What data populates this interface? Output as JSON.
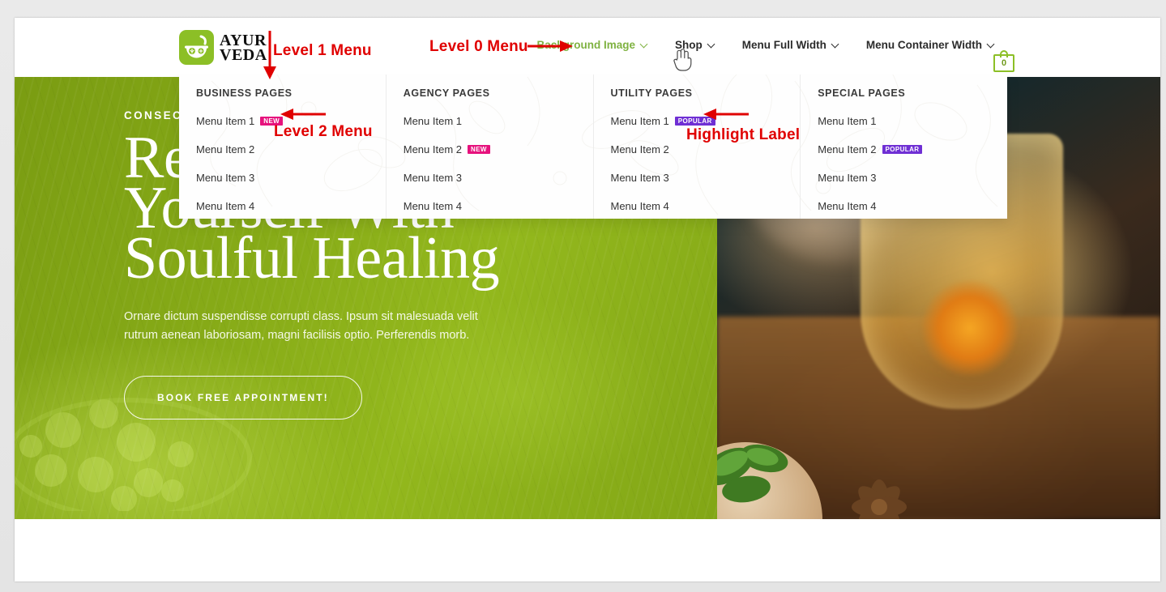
{
  "brand": {
    "logo_line1": "AYUR",
    "logo_line2": "VEDA",
    "logo_icon": "mortar-pestle-icon"
  },
  "nav": {
    "items": [
      {
        "label": "Background Image",
        "has_caret": true,
        "active": true
      },
      {
        "label": "Shop",
        "has_caret": true,
        "active": false
      },
      {
        "label": "Menu Full Width",
        "has_caret": true,
        "active": false
      },
      {
        "label": "Menu Container Width",
        "has_caret": true,
        "active": false
      }
    ],
    "cart": {
      "icon": "shopping-bag-icon",
      "count": "0"
    }
  },
  "mega_menu": {
    "columns": [
      {
        "title": "BUSINESS PAGES",
        "items": [
          {
            "label": "Menu Item 1",
            "badge": "NEW",
            "badge_type": "new"
          },
          {
            "label": "Menu Item 2",
            "badge": "",
            "badge_type": ""
          },
          {
            "label": "Menu Item 3",
            "badge": "",
            "badge_type": ""
          },
          {
            "label": "Menu Item 4",
            "badge": "",
            "badge_type": ""
          }
        ]
      },
      {
        "title": "AGENCY PAGES",
        "items": [
          {
            "label": "Menu Item 1",
            "badge": "",
            "badge_type": ""
          },
          {
            "label": "Menu Item 2",
            "badge": "NEW",
            "badge_type": "new"
          },
          {
            "label": "Menu Item 3",
            "badge": "",
            "badge_type": ""
          },
          {
            "label": "Menu Item 4",
            "badge": "",
            "badge_type": ""
          }
        ]
      },
      {
        "title": "UTILITY PAGES",
        "items": [
          {
            "label": "Menu Item 1",
            "badge": "POPULAR",
            "badge_type": "popular"
          },
          {
            "label": "Menu Item 2",
            "badge": "",
            "badge_type": ""
          },
          {
            "label": "Menu Item 3",
            "badge": "",
            "badge_type": ""
          },
          {
            "label": "Menu Item 4",
            "badge": "",
            "badge_type": ""
          }
        ]
      },
      {
        "title": "SPECIAL PAGES",
        "items": [
          {
            "label": "Menu Item 1",
            "badge": "",
            "badge_type": ""
          },
          {
            "label": "Menu Item 2",
            "badge": "POPULAR",
            "badge_type": "popular"
          },
          {
            "label": "Menu Item 3",
            "badge": "",
            "badge_type": ""
          },
          {
            "label": "Menu Item 4",
            "badge": "",
            "badge_type": ""
          }
        ]
      }
    ]
  },
  "hero": {
    "eyebrow": "CONSECTETUR ADIPISCING",
    "title_line1": "Rejuvenate",
    "title_line2": "Yourself With",
    "title_line3": "Soulful Healing",
    "subtitle": "Ornare dictum suspendisse corrupti class. Ipsum sit malesuada velit rutrum aenean laboriosam, magni facilisis optio. Perferendis morb.",
    "cta_label": "BOOK FREE APPOINTMENT!"
  },
  "annotations": [
    {
      "id": "level-1",
      "text": "Level 1 Menu"
    },
    {
      "id": "level-0",
      "text": "Level 0 Menu"
    },
    {
      "id": "level-2",
      "text": "Level 2 Menu"
    },
    {
      "id": "highlight",
      "text": "Highlight Label"
    }
  ],
  "colors": {
    "accent_green": "#8cbf26",
    "nav_active": "#7fb241",
    "badge_new": "#e6127d",
    "badge_popular": "#6f2fd4",
    "annotation_red": "#e00000",
    "hero_green": "#86aa17"
  }
}
